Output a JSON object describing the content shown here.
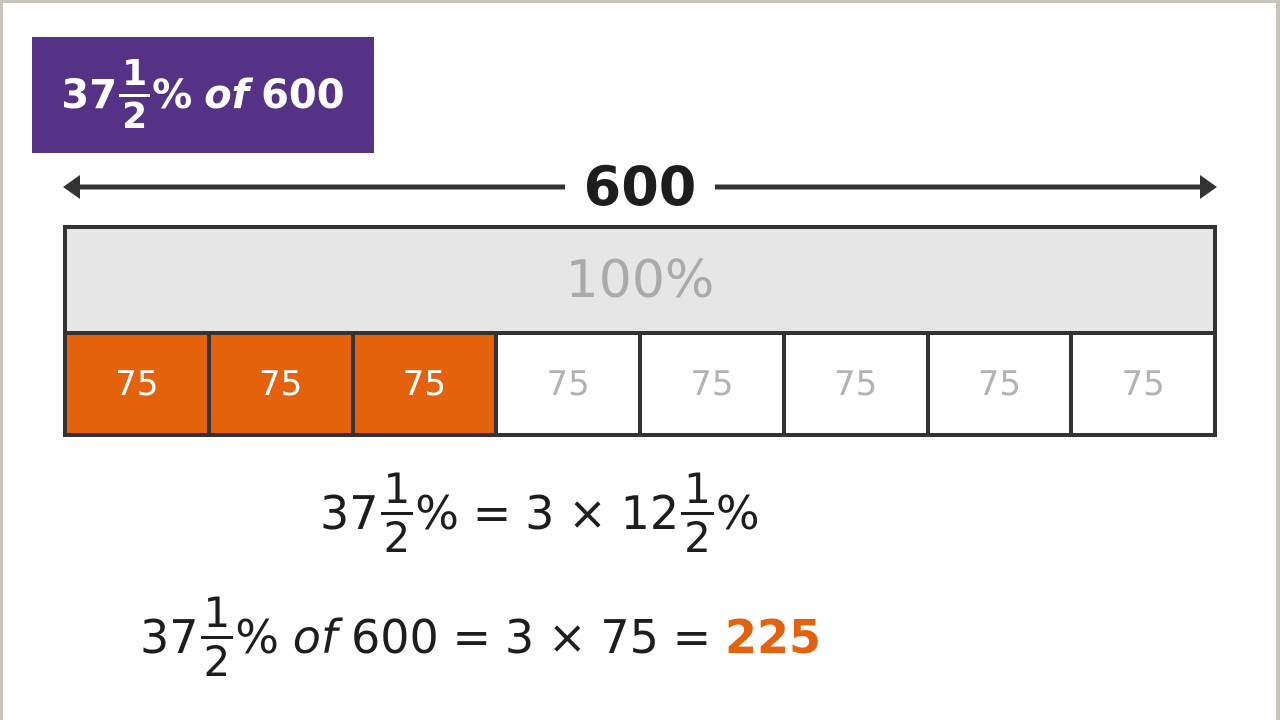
{
  "title": {
    "whole": "37",
    "numerator": "1",
    "denominator": "2",
    "percent": "%",
    "of": "of",
    "amount": "600"
  },
  "bar_model": {
    "total_label": "600",
    "whole_label": "100%",
    "parts": [
      {
        "label": "75",
        "shaded": true
      },
      {
        "label": "75",
        "shaded": true
      },
      {
        "label": "75",
        "shaded": true
      },
      {
        "label": "75",
        "shaded": false
      },
      {
        "label": "75",
        "shaded": false
      },
      {
        "label": "75",
        "shaded": false
      },
      {
        "label": "75",
        "shaded": false
      },
      {
        "label": "75",
        "shaded": false
      }
    ],
    "shaded_parts": 3,
    "total_parts": 8
  },
  "equation1": {
    "lhs_whole": "37",
    "lhs_num": "1",
    "lhs_den": "2",
    "lhs_pct": "%",
    "eq": "=",
    "factor": "3",
    "times": "×",
    "rhs_whole": "12",
    "rhs_num": "1",
    "rhs_den": "2",
    "rhs_pct": "%"
  },
  "equation2": {
    "lhs_whole": "37",
    "lhs_num": "1",
    "lhs_den": "2",
    "lhs_pct": "%",
    "of": "of",
    "amount": "600",
    "eq1": "=",
    "factor": "3",
    "times": "×",
    "part": "75",
    "eq2": "=",
    "answer": "225"
  },
  "colors": {
    "title_bg": "#553285",
    "shaded": "#e4620e",
    "whole_bg": "#e6e6e6",
    "answer": "#e4620e"
  }
}
